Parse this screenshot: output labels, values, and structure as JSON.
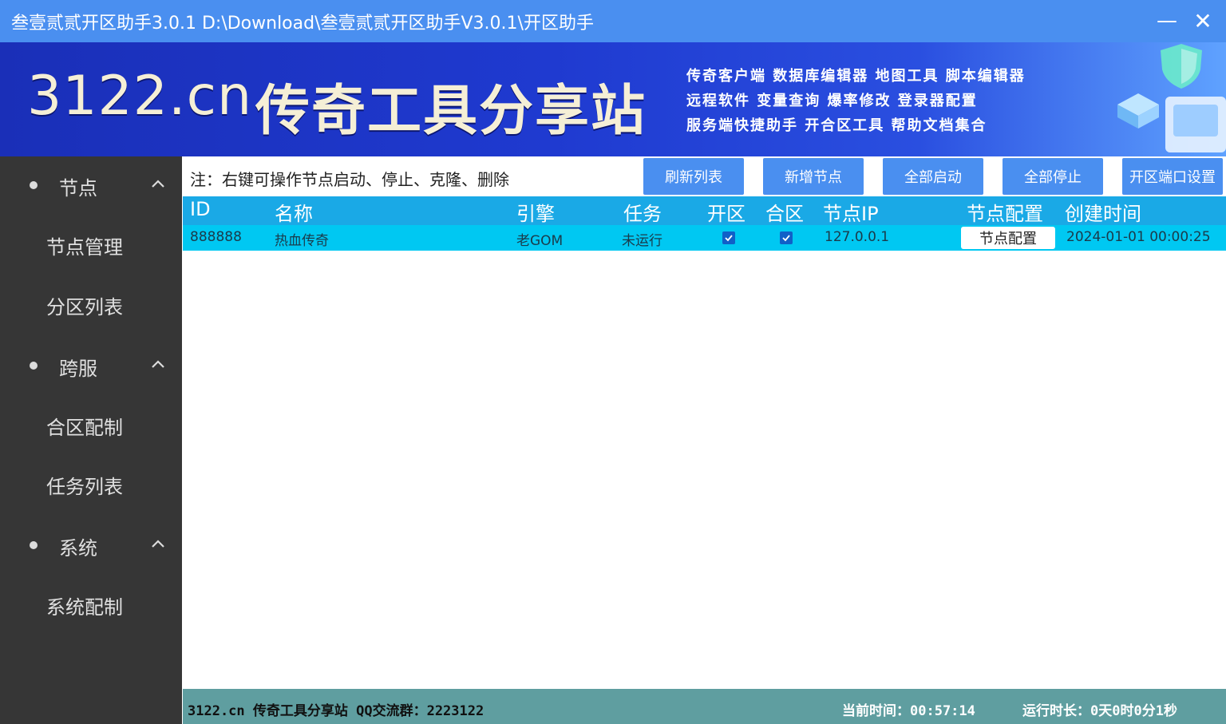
{
  "window": {
    "title": "叁壹贰贰开区助手3.0.1 D:\\Download\\叁壹贰贰开区助手V3.0.1\\开区助手",
    "minimize": "—",
    "close": "✕"
  },
  "banner": {
    "site": "3122.cn",
    "brand": "传奇工具分享站",
    "features": [
      "传奇客户端 数据库编辑器 地图工具 脚本编辑器",
      "远程软件 变量查询 爆率修改 登录器配置",
      "服务端快捷助手 开合区工具 帮助文档集合"
    ]
  },
  "sidebar": {
    "groups": [
      {
        "label": "节点",
        "items": [
          "节点管理",
          "分区列表"
        ]
      },
      {
        "label": "跨服",
        "items": [
          "合区配制",
          "任务列表"
        ]
      },
      {
        "label": "系统",
        "items": [
          "系统配制"
        ]
      }
    ]
  },
  "toolbar": {
    "note": "注：右键可操作节点启动、停止、克隆、删除",
    "buttons": [
      "刷新列表",
      "新增节点",
      "全部启动",
      "全部停止",
      "开区端口设置"
    ]
  },
  "table": {
    "headers": [
      "ID",
      "名称",
      "引擎",
      "任务",
      "开区",
      "合区",
      "节点IP",
      "节点配置",
      "创建时间"
    ],
    "rows": [
      {
        "id": "888888",
        "name": "热血传奇",
        "engine": "老GOM",
        "task": "未运行",
        "open": true,
        "merge": true,
        "ip": "127.0.0.1",
        "config_button": "节点配置",
        "created": "2024-01-01 00:00:25"
      }
    ]
  },
  "statusbar": {
    "site_info": "3122.cn 传奇工具分享站 QQ交流群：2223122",
    "current_time": "当前时间：00:57:14",
    "uptime": "运行时长：0天0时0分1秒"
  },
  "colors": {
    "titlebar": "#4a8ff0",
    "sidebar": "#363636",
    "table_header": "#1aa9e6",
    "table_row": "#00c8f2",
    "statusbar": "#5f9ea0"
  }
}
